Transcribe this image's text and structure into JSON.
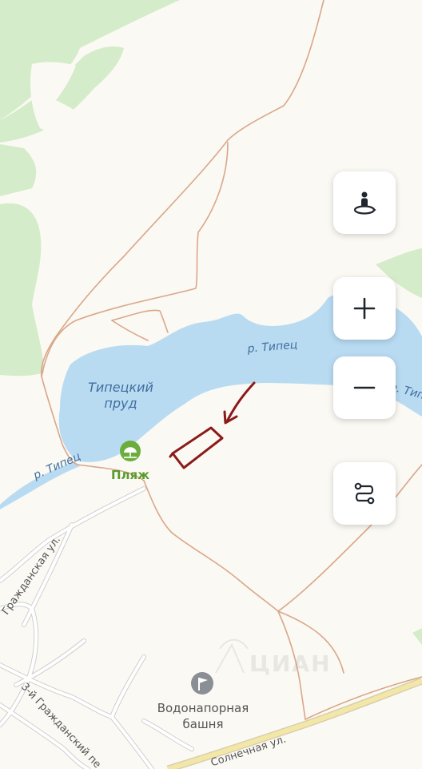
{
  "labels": {
    "pond": "Типецкий\nпруд",
    "river_top": "р. Типец",
    "river_left": "р. Типец",
    "river_right": "р. Типец",
    "beach": "Пляж",
    "water_tower": "Водонапорная\nбашня",
    "street_grazhdanskaya": "Гражданская ул.",
    "street_3_grazhdanskiy": "3-й Гражданский пе",
    "street_solnechnaya": "Солнечная ул."
  },
  "watermark": "ЦИАН",
  "controls": {
    "street_view": "street-view-icon",
    "zoom_in": "plus-icon",
    "zoom_out": "minus-icon",
    "route": "route-icon"
  },
  "colors": {
    "land": "#fbf9f3",
    "forest": "#d4ecc9",
    "water": "#b9dbf2",
    "road": "#d9a78a",
    "highway": "#f3e7a8",
    "annotation": "#8b1a1a",
    "poi_green": "#6bae3d",
    "label_water": "#3f6e9e"
  }
}
